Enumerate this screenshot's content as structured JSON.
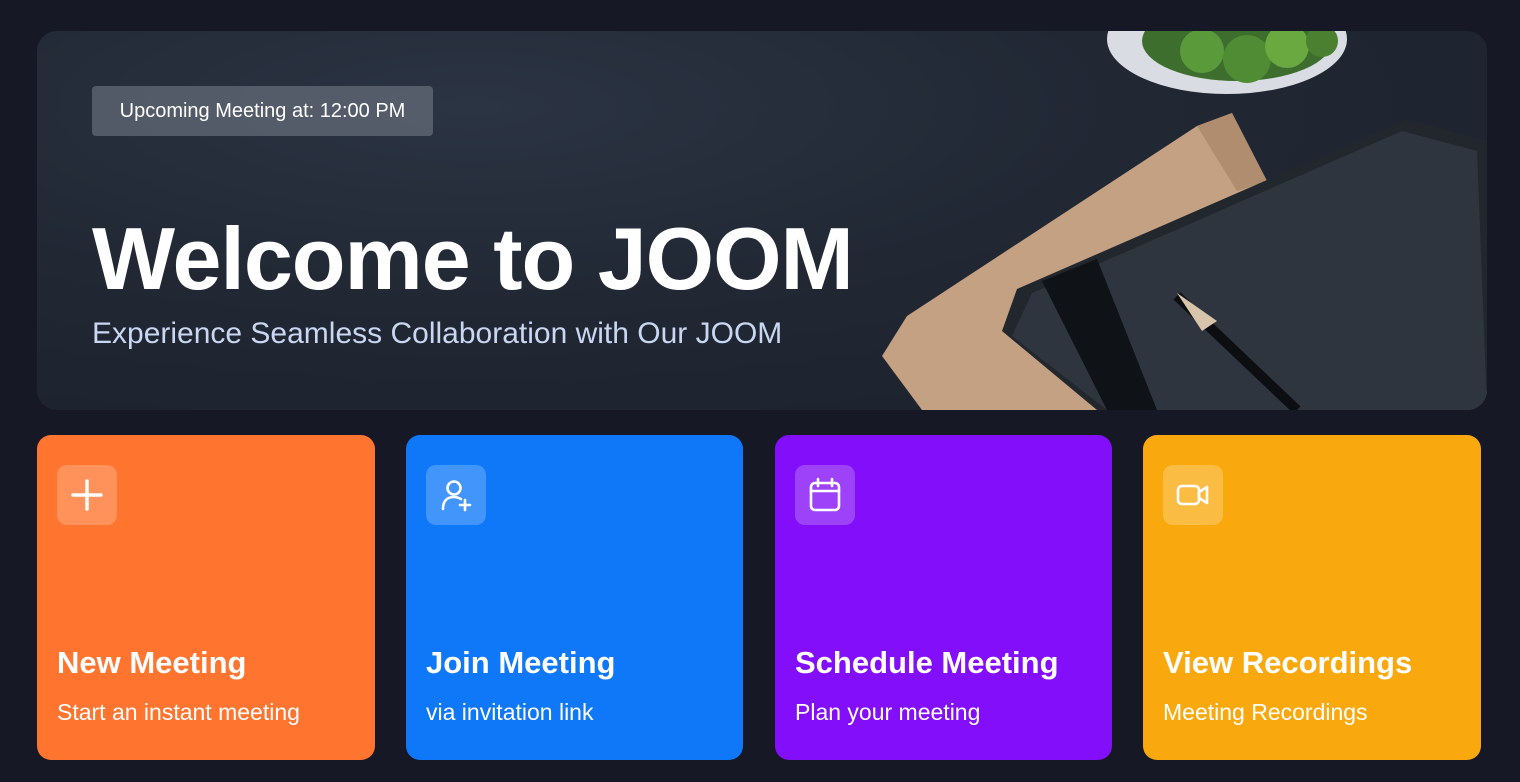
{
  "hero": {
    "upcoming": "Upcoming Meeting at: 12:00 PM",
    "title": "Welcome to JOOM",
    "subtitle": "Experience Seamless Collaboration with Our JOOM"
  },
  "cards": [
    {
      "title": "New Meeting",
      "subtitle": "Start an instant meeting",
      "icon": "plus-icon",
      "color": "#FF742E"
    },
    {
      "title": "Join Meeting",
      "subtitle": "via invitation link",
      "icon": "user-plus-icon",
      "color": "#0E78F9"
    },
    {
      "title": "Schedule Meeting",
      "subtitle": "Plan your meeting",
      "icon": "calendar-icon",
      "color": "#830EF9"
    },
    {
      "title": "View Recordings",
      "subtitle": "Meeting Recordings",
      "icon": "video-icon",
      "color": "#F9A90E"
    }
  ],
  "colors": {
    "background": "#161925",
    "hero_subtitle": "#C9D7F2"
  }
}
